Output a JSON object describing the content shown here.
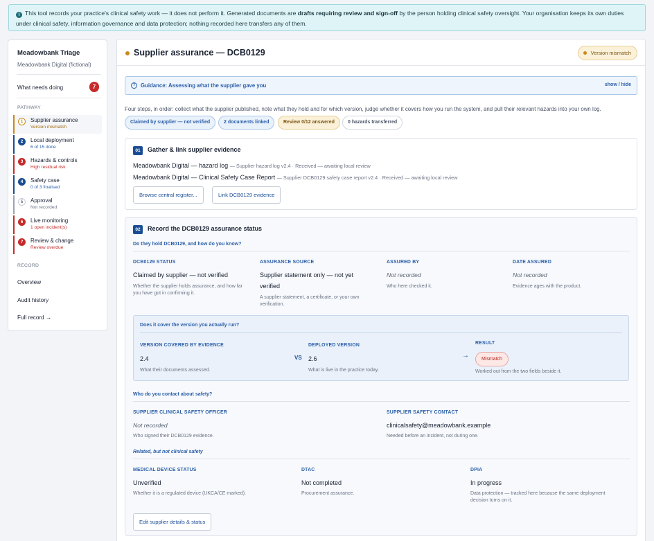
{
  "banner": {
    "pre": "This tool records your practice's clinical safety work — it does not perform it. Generated documents are ",
    "bold": "drafts requiring review and sign-off",
    "post": " by the person holding clinical safety oversight. Your organisation keeps its own duties under clinical safety, information governance and data protection; nothing recorded here transfers any of them."
  },
  "sidebar": {
    "org_name": "Meadowbank Triage",
    "org_sub": "Meadowbank Digital (fictional)",
    "needs_doing": {
      "label": "What needs doing",
      "count": "7"
    },
    "pathway_heading": "PATHWAY",
    "steps": [
      {
        "num": "1",
        "label": "Supplier assurance",
        "status": "Version mismatch",
        "color": "#c9891a",
        "status_color": "#a36a10",
        "active": true
      },
      {
        "num": "2",
        "label": "Local deployment",
        "status": "6 of 15 done",
        "color": "#1b4d94",
        "status_color": "#2a5ea8"
      },
      {
        "num": "3",
        "label": "Hazards & controls",
        "status": "High residual risk",
        "color": "#c62b2b",
        "status_color": "#c62b2b"
      },
      {
        "num": "4",
        "label": "Safety case",
        "status": "0 of 3 finalised",
        "color": "#1b4d94",
        "status_color": "#2a5ea8"
      },
      {
        "num": "5",
        "label": "Approval",
        "status": "Not recorded",
        "color": "#9aa3b1",
        "status_color": "#6b7384"
      },
      {
        "num": "6",
        "label": "Live monitoring",
        "status": "1 open incident(s)",
        "color": "#c62b2b",
        "status_color": "#c62b2b"
      },
      {
        "num": "7",
        "label": "Review & change",
        "status": "Review overdue",
        "color": "#c62b2b",
        "status_color": "#c62b2b"
      }
    ],
    "record_heading": "RECORD",
    "record_links": [
      "Overview",
      "Audit history",
      "Full record →"
    ]
  },
  "main": {
    "title": "Supplier assurance — DCB0129",
    "status_pill": "Version mismatch",
    "guidance": {
      "title": "Guidance: Assessing what the supplier gave you",
      "toggle": "show / hide"
    },
    "intro": "Four steps, in order: collect what the supplier published, note what they hold and for which version, judge whether it covers how you run the system, and pull their relevant hazards into your own log.",
    "chips": [
      "Claimed by supplier — not verified",
      "2 documents linked",
      "Review 0/12 answered",
      "0 hazards transferred"
    ],
    "card1": {
      "num": "01",
      "title": "Gather & link supplier evidence",
      "evidence": [
        {
          "name": "Meadowbank Digital — hazard log",
          "meta": "— Supplier hazard log v2.4 · Received — awaiting local review"
        },
        {
          "name": "Meadowbank Digital — Clinical Safety Case Report",
          "meta": "— Supplier DCB0129 safety case report v2.4 · Received — awaiting local review"
        }
      ],
      "browse_button": "Browse central register...",
      "link_button": "Link DCB0129 evidence"
    },
    "card2": {
      "num": "02",
      "title": "Record the DCB0129 assurance status",
      "q1": "Do they hold DCB0129, and how do you know?",
      "fields": [
        {
          "label": "DCB0129 STATUS",
          "value": "Claimed by supplier — not verified",
          "hint": "Whether the supplier holds assurance, and how far you have got in confirming it."
        },
        {
          "label": "ASSURANCE SOURCE",
          "value": "Supplier statement only — not yet verified",
          "hint": "A supplier statement, a certificate, or your own verification."
        },
        {
          "label": "ASSURED BY",
          "value": "Not recorded",
          "hint": "Who here checked it."
        },
        {
          "label": "DATE ASSURED",
          "value": "Not recorded",
          "hint": "Evidence ages with the product."
        }
      ],
      "version": {
        "question": "Does it cover the version you actually run?",
        "covered_label": "VERSION COVERED BY EVIDENCE",
        "covered_value": "2.4",
        "covered_hint": "What their documents assessed.",
        "vs": "VS",
        "deployed_label": "DEPLOYED VERSION",
        "deployed_value": "2.6",
        "deployed_hint": "What is live in the practice today.",
        "arrow": "→",
        "result_label": "RESULT",
        "result_value": "Mismatch",
        "result_hint": "Worked out from the two fields beside it."
      },
      "q2": "Who do you contact about safety?",
      "contacts": [
        {
          "label": "SUPPLIER CLINICAL SAFETY OFFICER",
          "value": "Not recorded",
          "hint": "Who signed their DCB0129 evidence."
        },
        {
          "label": "SUPPLIER SAFETY CONTACT",
          "value": "clinicalsafety@meadowbank.example",
          "hint": "Needed before an incident, not during one."
        }
      ],
      "q3": "Related, but not clinical safety",
      "related": [
        {
          "label": "MEDICAL DEVICE STATUS",
          "value": "Unverified",
          "hint": "Whether it is a regulated device (UKCA/CE marked)."
        },
        {
          "label": "DTAC",
          "value": "Not completed",
          "hint": "Procurement assurance."
        },
        {
          "label": "DPIA",
          "value": "In progress",
          "hint": "Data protection — tracked here because the same deployment decision turns on it."
        }
      ],
      "edit_button": "Edit supplier details & status"
    }
  }
}
